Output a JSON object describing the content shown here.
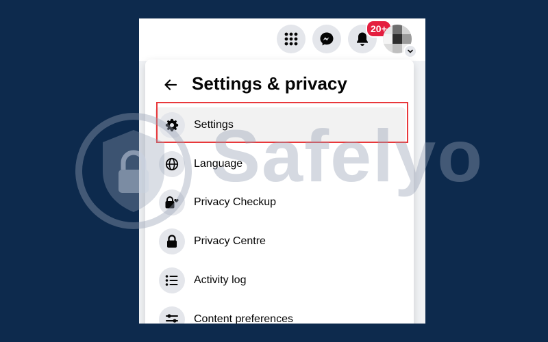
{
  "header": {
    "notification_badge": "20+",
    "icons": [
      "apps-grid-icon",
      "messenger-icon",
      "bell-icon",
      "avatar",
      "chevron-down-icon"
    ]
  },
  "menu": {
    "title": "Settings & privacy",
    "items": [
      {
        "label": "Settings",
        "icon": "gear-icon",
        "highlighted": true
      },
      {
        "label": "Language",
        "icon": "globe-icon"
      },
      {
        "label": "Privacy Checkup",
        "icon": "lock-heart-icon"
      },
      {
        "label": "Privacy Centre",
        "icon": "lock-icon"
      },
      {
        "label": "Activity log",
        "icon": "list-icon"
      },
      {
        "label": "Content preferences",
        "icon": "sliders-icon"
      }
    ]
  },
  "watermark": {
    "text": "Safelyo"
  },
  "colors": {
    "background": "#0d2a4d",
    "highlight_border": "#e8383b",
    "badge": "#e41e3f",
    "icon_bg": "#e4e6eb"
  }
}
